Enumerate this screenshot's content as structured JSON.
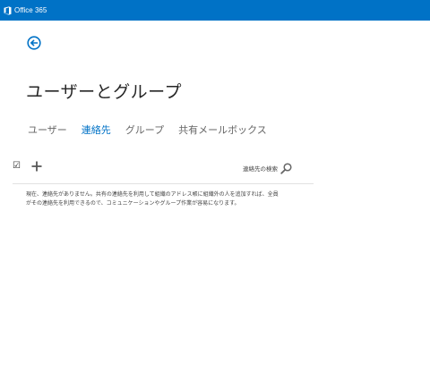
{
  "header": {
    "brand": "Office 365",
    "accent_color": "#0072c6",
    "logo_icon": "office-logo-icon"
  },
  "back_icon": "back-arrow-icon",
  "page": {
    "title": "ユーザーとグループ"
  },
  "tabs": [
    {
      "label": "ユーザー",
      "active": false
    },
    {
      "label": "連絡先",
      "active": true
    },
    {
      "label": "グループ",
      "active": false
    },
    {
      "label": "共有メールボックス",
      "active": false
    }
  ],
  "toolbar": {
    "select_all_glyph": "☑",
    "add_icon": "plus-icon",
    "search_label": "連絡先の検索",
    "search_icon": "search-icon"
  },
  "info": {
    "line1": "現在、連絡先がありません。共有の連絡先を利用して組織のアドレス帳に組織外の人を追加すれば、全員",
    "line2": "がその連絡先を利用できるので、コミュニケーションやグループ作業が容易になります。"
  }
}
